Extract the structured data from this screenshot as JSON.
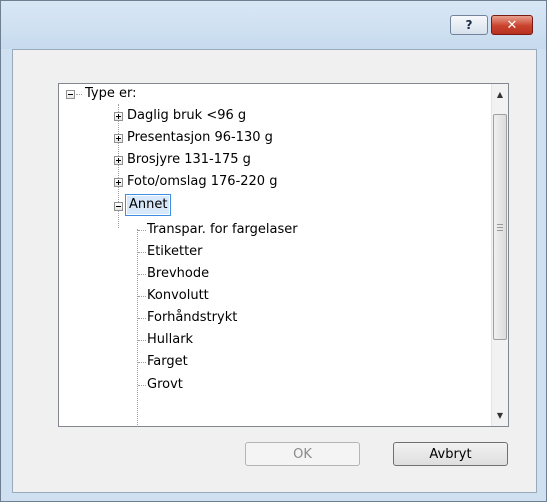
{
  "window": {
    "help_label": "?",
    "close_label": "✕"
  },
  "tree": {
    "root": "Type er:",
    "categories": [
      "Daglig bruk <96 g",
      "Presentasjon 96-130 g",
      "Brosjyre 131-175 g",
      "Foto/omslag 176-220 g"
    ],
    "selected": "Annet",
    "children": [
      "Transpar. for fargelaser",
      "Etiketter",
      "Brevhode",
      "Konvolutt",
      "Forhåndstrykt",
      "Hullark",
      "Farget",
      "Grovt"
    ]
  },
  "buttons": {
    "ok": "OK",
    "cancel": "Avbryt"
  }
}
